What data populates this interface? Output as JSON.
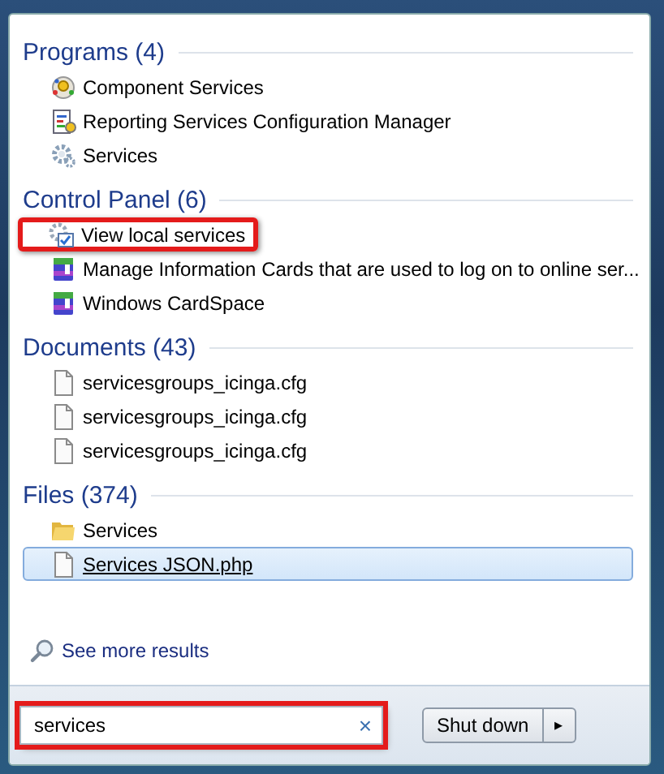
{
  "sections": [
    {
      "title": "Programs (4)",
      "items": [
        {
          "label": "Component Services",
          "kind": "component",
          "selected": false,
          "highlighted": false
        },
        {
          "label": "Reporting Services Configuration Manager",
          "kind": "report",
          "selected": false,
          "highlighted": false
        },
        {
          "label": "Services",
          "kind": "gear",
          "selected": false,
          "highlighted": false
        }
      ]
    },
    {
      "title": "Control Panel (6)",
      "items": [
        {
          "label": "View local services",
          "kind": "gear-check",
          "selected": false,
          "highlighted": true
        },
        {
          "label": "Manage Information Cards that are used to log on to online ser...",
          "kind": "card",
          "selected": false,
          "highlighted": false
        },
        {
          "label": "Windows CardSpace",
          "kind": "card",
          "selected": false,
          "highlighted": false
        }
      ]
    },
    {
      "title": "Documents (43)",
      "items": [
        {
          "label": "servicesgroups_icinga.cfg",
          "kind": "file",
          "selected": false,
          "highlighted": false
        },
        {
          "label": "servicesgroups_icinga.cfg",
          "kind": "file",
          "selected": false,
          "highlighted": false
        },
        {
          "label": "servicesgroups_icinga.cfg",
          "kind": "file",
          "selected": false,
          "highlighted": false
        }
      ]
    },
    {
      "title": "Files (374)",
      "items": [
        {
          "label": "Services",
          "kind": "folder",
          "selected": false,
          "highlighted": false
        },
        {
          "label": "Services JSON.php",
          "kind": "file",
          "selected": true,
          "highlighted": false
        }
      ]
    }
  ],
  "see_more": "See more results",
  "search": {
    "value": "services",
    "clear": "×",
    "highlighted": true
  },
  "shutdown": {
    "label": "Shut down",
    "arrow": "▸"
  }
}
